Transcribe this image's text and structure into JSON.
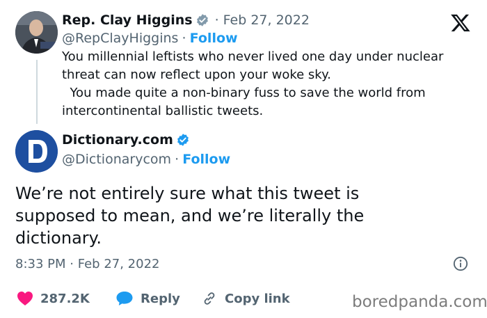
{
  "quoted_tweet": {
    "name": "Rep. Clay Higgins",
    "date": "Feb 27, 2022",
    "handle": "@RepClayHiggins",
    "follow_label": "Follow",
    "text": "You millennial leftists who never lived one day under nuclear threat can now reflect upon your woke sky.\n  You made quite a non-binary fuss to save the world from intercontinental ballistic tweets."
  },
  "main_tweet": {
    "name": "Dictionary.com",
    "handle": "@Dictionarycom",
    "follow_label": "Follow",
    "text": "We’re not entirely sure what this tweet is supposed to mean, and we’re literally the dictionary.",
    "time": "8:33 PM",
    "date": "Feb 27, 2022"
  },
  "actions": {
    "like_count": "287.2K",
    "reply_label": "Reply",
    "copy_link_label": "Copy link"
  },
  "separator": "·",
  "watermark": "boredpanda.com",
  "colors": {
    "accent": "#1d9bf0",
    "like": "#f91880",
    "reply_icon": "#1d9bf0",
    "dictionary_brand": "#1e4fa0"
  }
}
